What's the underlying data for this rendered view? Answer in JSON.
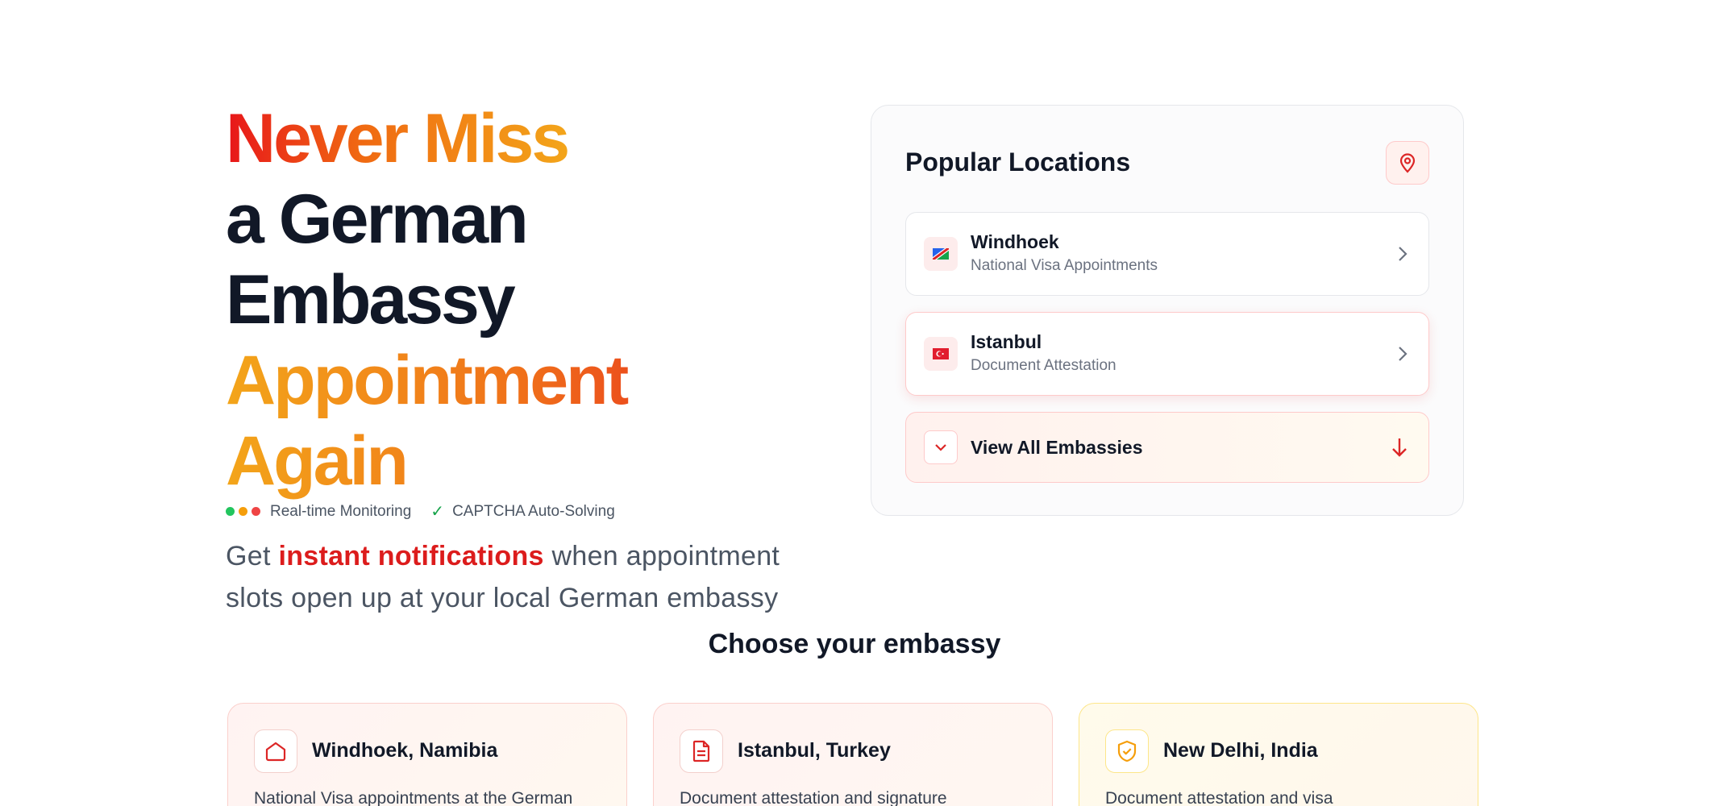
{
  "hero": {
    "headline_line1": "Never Miss",
    "headline_line2": "a German Embassy",
    "headline_line3": "Appointment Again",
    "subtitle_before": "Get ",
    "subtitle_accent": "instant notifications",
    "subtitle_after": " when appointment slots open up at your local German embassy",
    "features": {
      "monitoring": "Real-time Monitoring",
      "captcha": "CAPTCHA Auto-Solving"
    },
    "status_dot_colors": [
      "#22c55e",
      "#f59e0b",
      "#ef4444"
    ]
  },
  "popular_locations": {
    "title": "Popular Locations",
    "icon": "map-pin-icon",
    "items": [
      {
        "name": "Windhoek",
        "subtitle": "National Visa Appointments",
        "flag": "namibia-flag-icon"
      },
      {
        "name": "Istanbul",
        "subtitle": "Document Attestation",
        "flag": "turkey-flag-icon"
      }
    ],
    "view_all_label": "View All Embassies"
  },
  "choose_section": {
    "title": "Choose your embassy",
    "cards": [
      {
        "name": "Windhoek, Namibia",
        "description": "National Visa appointments at the German",
        "icon": "home-icon"
      },
      {
        "name": "Istanbul, Turkey",
        "description": "Document attestation and signature",
        "icon": "document-icon"
      },
      {
        "name": "New Delhi, India",
        "description": "Document attestation and visa",
        "icon": "shield-check-icon"
      }
    ]
  },
  "colors": {
    "accent_red": "#dc2626",
    "accent_orange": "#f59e0b",
    "text_dark": "#111827"
  }
}
